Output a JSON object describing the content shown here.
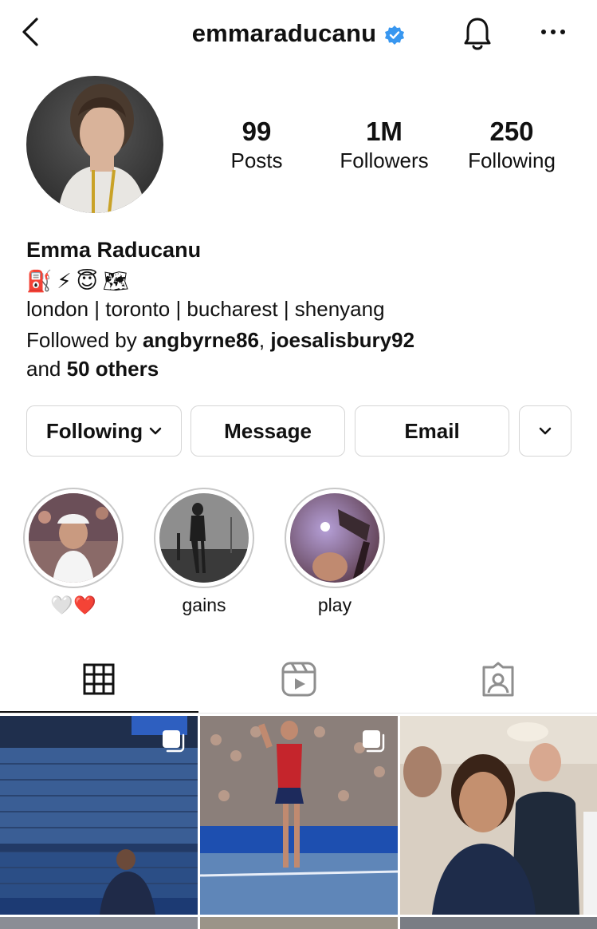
{
  "header": {
    "username": "emmaraducanu"
  },
  "stats": [
    {
      "value": "99",
      "label": "Posts"
    },
    {
      "value": "1M",
      "label": "Followers"
    },
    {
      "value": "250",
      "label": "Following"
    }
  ],
  "bio": {
    "name": "Emma Raducanu",
    "emojis": [
      "⛽",
      "⚡",
      "😇",
      "🗺"
    ],
    "location": "london | toronto | bucharest | shenyang",
    "followed_prefix": "Followed by ",
    "followed_user1": "angbyrne86",
    "followed_sep": ", ",
    "followed_user2": "joesalisbury92",
    "followed_and": "and ",
    "followed_others": "50 others"
  },
  "actions": {
    "following": "Following",
    "message": "Message",
    "email": "Email"
  },
  "highlights": [
    {
      "label": "🤍❤️"
    },
    {
      "label": "gains"
    },
    {
      "label": "play"
    }
  ],
  "tabs": [
    "grid-icon",
    "reels-icon",
    "tagged-icon"
  ],
  "grid_posts": [
    {
      "name": "post-us-open-stadium",
      "multi": true
    },
    {
      "name": "post-court-wave",
      "multi": true
    },
    {
      "name": "post-selfie-group",
      "multi": false
    }
  ],
  "colors": {
    "verified": "#3897f0",
    "text": "#111111",
    "border": "#d5d5d5"
  }
}
